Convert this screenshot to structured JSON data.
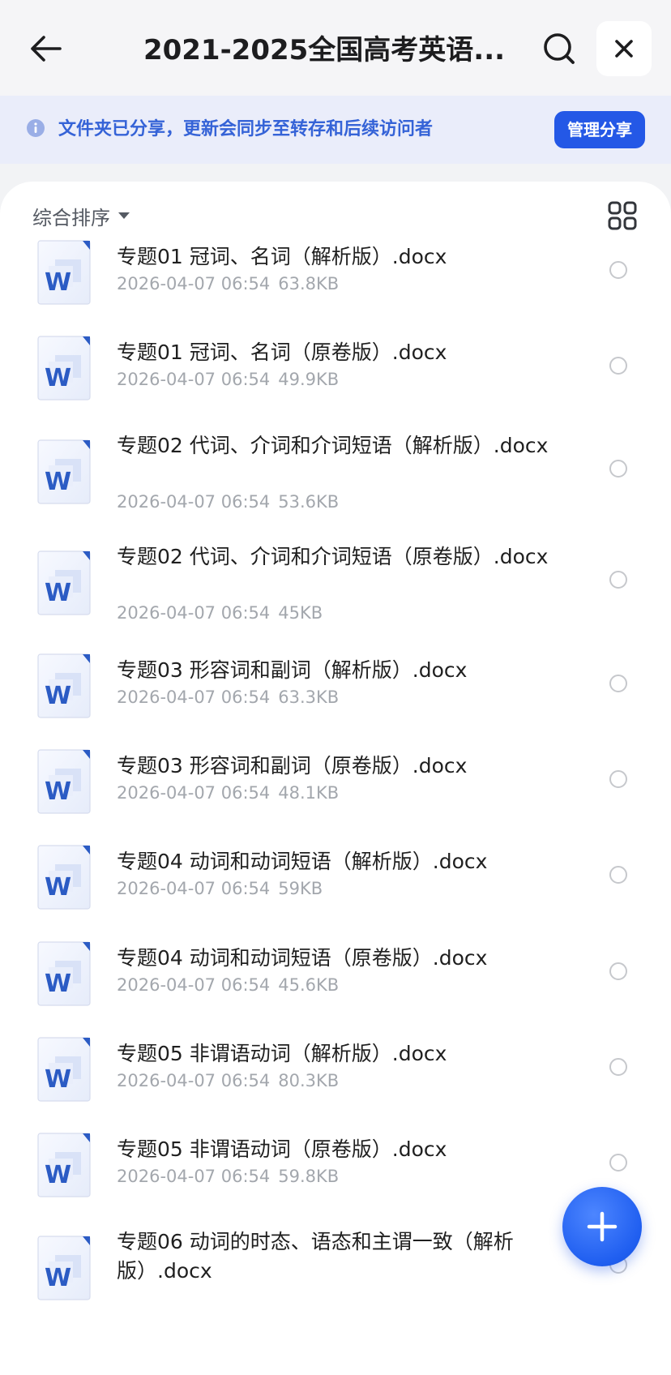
{
  "header": {
    "title": "2021-2025全国高考英语...",
    "back_icon": "arrow-left-icon",
    "search_icon": "search-icon",
    "close_icon": "close-icon"
  },
  "banner": {
    "text": "文件夹已分享，更新会同步至转存和后续访问者",
    "button_label": "管理分享",
    "icon": "info-icon"
  },
  "toolbar": {
    "sort_label": "综合排序",
    "view_icon": "grid-view-icon"
  },
  "files": [
    {
      "name": "专题01 冠词、名词（解析版）.docx",
      "date": "2026-04-07 06:54",
      "size": "63.8KB"
    },
    {
      "name": "专题01 冠词、名词（原卷版）.docx",
      "date": "2026-04-07 06:54",
      "size": "49.9KB"
    },
    {
      "name": "专题02 代词、介词和介词短语（解析版）.docx",
      "date": "2026-04-07 06:54",
      "size": "53.6KB"
    },
    {
      "name": "专题02 代词、介词和介词短语（原卷版）.docx",
      "date": "2026-04-07 06:54",
      "size": "45KB"
    },
    {
      "name": "专题03 形容词和副词（解析版）.docx",
      "date": "2026-04-07 06:54",
      "size": "63.3KB"
    },
    {
      "name": "专题03 形容词和副词（原卷版）.docx",
      "date": "2026-04-07 06:54",
      "size": "48.1KB"
    },
    {
      "name": "专题04 动词和动词短语（解析版）.docx",
      "date": "2026-04-07 06:54",
      "size": "59KB"
    },
    {
      "name": "专题04 动词和动词短语（原卷版）.docx",
      "date": "2026-04-07 06:54",
      "size": "45.6KB"
    },
    {
      "name": "专题05 非谓语动词（解析版）.docx",
      "date": "2026-04-07 06:54",
      "size": "80.3KB"
    },
    {
      "name": "专题05 非谓语动词（原卷版）.docx",
      "date": "2026-04-07 06:54",
      "size": "59.8KB"
    },
    {
      "name": "专题06 动词的时态、语态和主谓一致（解析版）.docx",
      "date": "",
      "size": ""
    }
  ],
  "colors": {
    "accent": "#2458e6",
    "banner_bg": "#eaedfa",
    "banner_text": "#3563d7",
    "meta_text": "#a3a7ad",
    "word_blue": "#2b5bc4"
  },
  "fab_icon": "plus-icon"
}
